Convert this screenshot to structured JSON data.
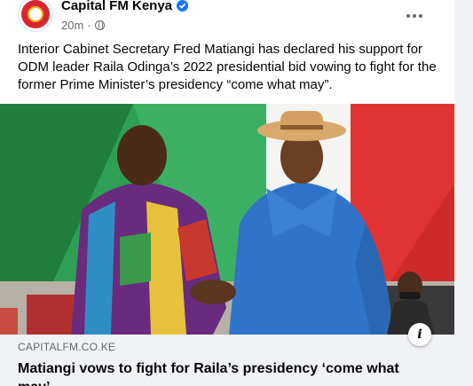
{
  "post": {
    "page_name": "Capital FM Kenya",
    "timestamp": "20m",
    "separator": "·",
    "privacy_icon": "globe-icon",
    "verified_icon": "verified-badge-icon",
    "more_icon": "more-options-icon",
    "text": "Interior Cabinet Secretary Fred Matiangi has declared his support for ODM leader Raila Odinga’s 2022 presidential bid vowing to fight for the former Prime Minister’s presidency “come what may”."
  },
  "link_preview": {
    "domain": "CAPITALFM.CO.KE",
    "title": "Matiangi vows to fight for Raila’s presidency ‘come what may’",
    "info_label": "i"
  },
  "colors": {
    "accent": "#1877f2",
    "secondary_text": "#65676b",
    "preview_bg": "#f0f2f5",
    "avatar_red": "#d7262e"
  }
}
